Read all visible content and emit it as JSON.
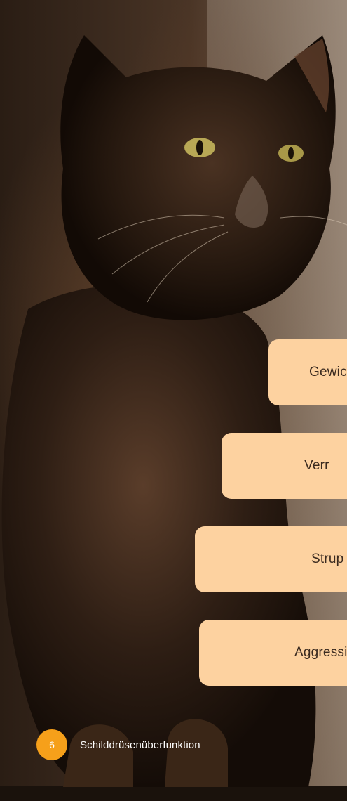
{
  "symptoms": [
    {
      "label": "Gewic"
    },
    {
      "label": "Verr"
    },
    {
      "label": "Strup"
    },
    {
      "label": "Aggressi"
    }
  ],
  "footer": {
    "page_number": "6",
    "section_title": "Schilddrüsenüberfunktion"
  },
  "colors": {
    "pill": "#fdd2a0",
    "page_badge": "#f6a01a",
    "text_dark": "#3a2a1f"
  }
}
